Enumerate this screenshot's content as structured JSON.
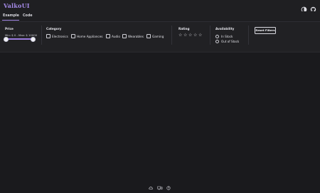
{
  "app": {
    "title": "ValkoUI"
  },
  "tabs": [
    {
      "label": "Example",
      "active": true
    },
    {
      "label": "Code",
      "active": false
    }
  ],
  "colors": {
    "accent": "#a58ae8",
    "background": "#1c1c1f",
    "panel": "#212124"
  },
  "filters": {
    "price": {
      "title": "Price",
      "range_text": "Min: $ 0 - Max: $ 10000",
      "min": 0,
      "max": 10000
    },
    "category": {
      "title": "Category",
      "options": [
        "Electronics",
        "Home Appliances",
        "Audio",
        "Wearables",
        "Gaming"
      ]
    },
    "rating": {
      "title": "Rating",
      "stars": 5,
      "selected": 0
    },
    "availability": {
      "title": "Availability",
      "options": [
        "In Stock",
        "Out of Stock"
      ]
    },
    "reset_label": "Reset Filters"
  },
  "icons": {
    "theme_toggle": "contrast-icon",
    "github": "github-icon"
  },
  "footer": {
    "icons": [
      "cloud-icon",
      "device-icon",
      "help-icon"
    ]
  }
}
